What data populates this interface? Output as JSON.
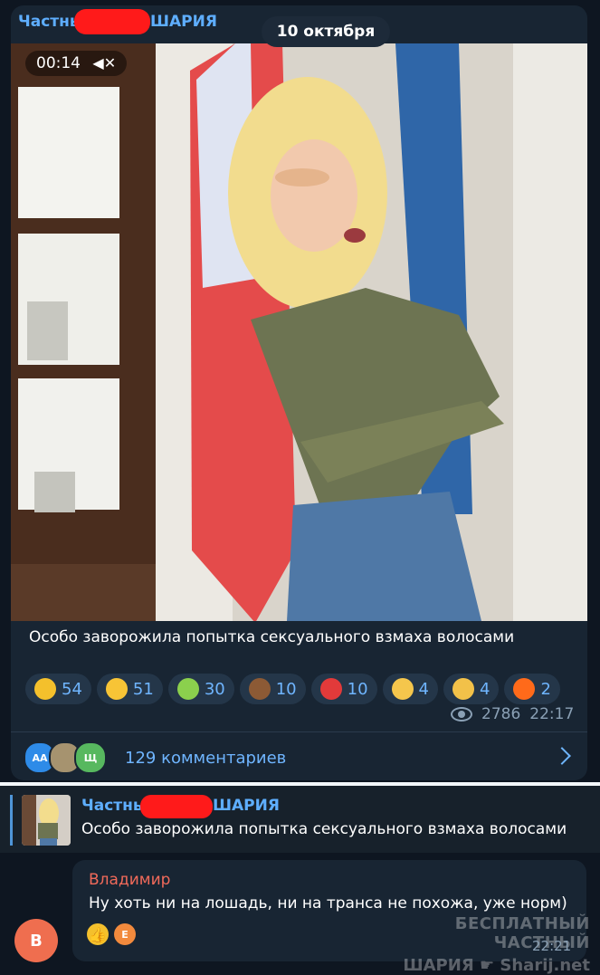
{
  "post": {
    "channel_name_start": "Частны",
    "channel_name_end": "ШАРИЯ",
    "date_pill": "10 октября",
    "video": {
      "timer": "00:14",
      "mute_icon": "muted-speaker-icon"
    },
    "caption": "Особо заворожила попытка сексуального взмаха волосами",
    "reactions": [
      {
        "emoji": "rofl",
        "count": "54"
      },
      {
        "emoji": "grin",
        "count": "51"
      },
      {
        "emoji": "vomit",
        "count": "30"
      },
      {
        "emoji": "poop",
        "count": "10"
      },
      {
        "emoji": "heart-fire",
        "count": "10"
      },
      {
        "emoji": "thumbs-up",
        "count": "4"
      },
      {
        "emoji": "woozy",
        "count": "4"
      },
      {
        "emoji": "fire",
        "count": "2"
      }
    ],
    "views": "2786",
    "time": "22:17",
    "comment_avatars": [
      "АА",
      "Щ"
    ],
    "comments_label": "129 комментариев"
  },
  "reply": {
    "title_start": "Частны",
    "title_end": "ШАРИЯ",
    "text": "Особо заворожила попытка сексуального взмаха волосами"
  },
  "comment": {
    "author": "Владимир",
    "text": "Ну хоть ни на лошадь, ни на транса не похожа, уже норм)",
    "avatar_letter": "В",
    "reaction_avatar": "E",
    "time": "22:21"
  },
  "watermark": {
    "line1": "БЕСПЛАТНЫЙ ЧАСТНЫЙ",
    "line2": "ШАРИЯ",
    "site": "Sharij.net"
  },
  "colors": {
    "background": "#0e1621",
    "card": "#182533",
    "accent": "#5eaeff",
    "author_name": "#f16a5a"
  }
}
